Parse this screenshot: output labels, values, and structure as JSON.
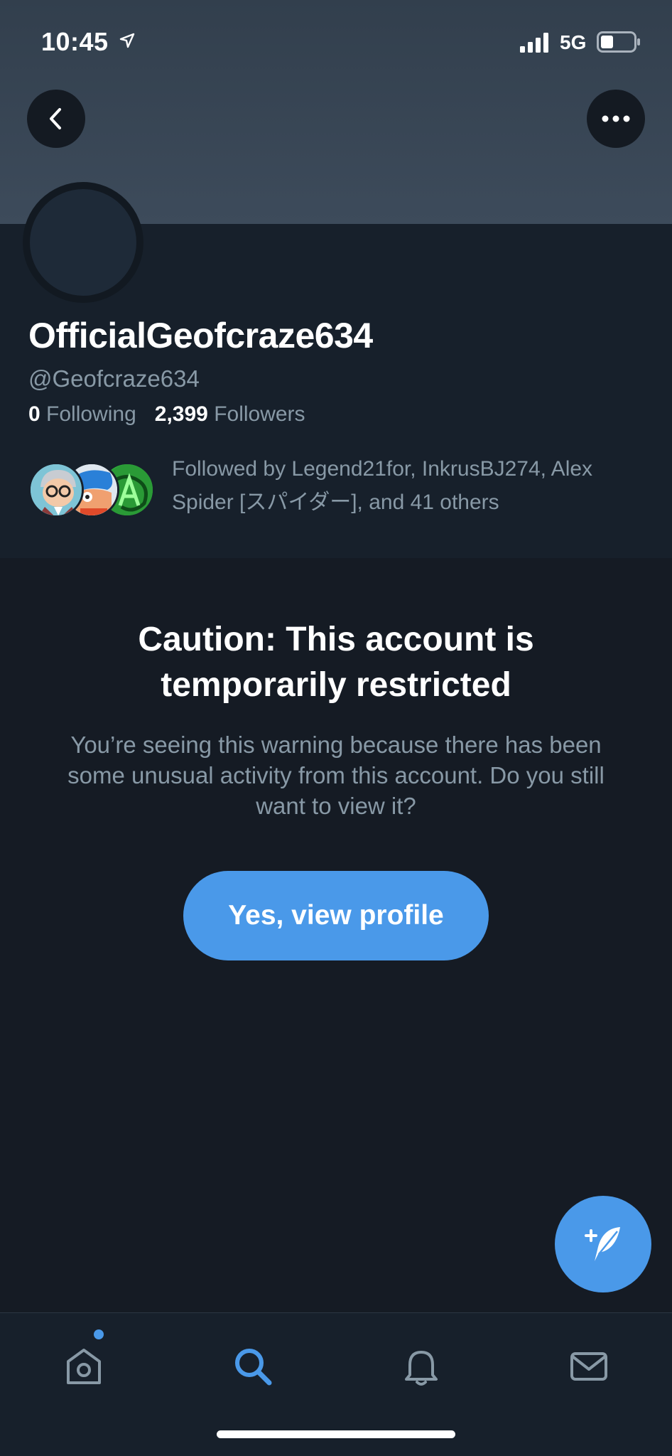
{
  "status_bar": {
    "time": "10:45",
    "network": "5G"
  },
  "profile": {
    "display_name": "OfficialGeofcraze634",
    "handle": "@Geofcraze634",
    "following_count": "0",
    "following_label": "Following",
    "followers_count": "2,399",
    "followers_label": "Followers",
    "followed_by": "Followed by Legend21for, InkrusBJ274, Alex Spider [スパイダー], and 41 others"
  },
  "warning": {
    "title": "Caution: This account is temporarily restricted",
    "body": "You’re seeing this warning because there has been some unusual activity from this account. Do you still want to view it?",
    "button_label": "Yes, view profile"
  },
  "tab_bar": {
    "tabs": [
      "home-icon",
      "search-icon",
      "bell-icon",
      "mail-icon"
    ],
    "active": "search-icon"
  },
  "colors": {
    "accent": "#4a99e9",
    "background": "#151b24",
    "panel": "#17202b",
    "muted_text": "#8899a6"
  }
}
